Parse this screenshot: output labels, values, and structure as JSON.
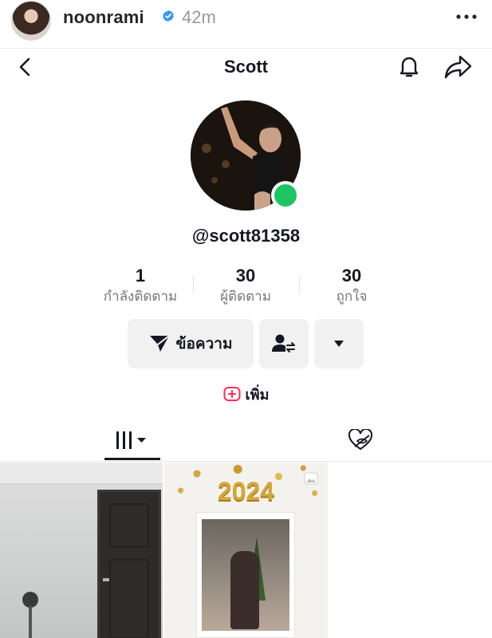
{
  "story": {
    "username": "noonrami",
    "time": "42m",
    "icons": {
      "verified": "verified-badge-icon",
      "more": "more-options-icon"
    },
    "colors": {
      "verified": "#3897f0"
    }
  },
  "nav": {
    "title": "Scott",
    "icons": {
      "back": "back-chevron-icon",
      "notifications": "bell-icon",
      "share": "share-arrow-icon"
    }
  },
  "profile": {
    "handle": "@scott81358",
    "online": true,
    "colors": {
      "online": "#1ec563"
    },
    "stats": [
      {
        "value": "1",
        "label": "กำลังติดตาม"
      },
      {
        "value": "30",
        "label": "ผู้ติดตาม"
      },
      {
        "value": "30",
        "label": "ถูกใจ"
      }
    ],
    "actions": {
      "message_label": "ข้อความ",
      "message_icon": "send-plane-icon",
      "follow_icon": "user-swap-icon",
      "more_icon": "caret-down-icon"
    },
    "add_label": "เพิ่ม",
    "add_icon": "plus-square-icon",
    "colors_accent": "#fe2c55"
  },
  "tabs": [
    {
      "name": "videos",
      "icon": "grid-bars-icon",
      "active": true
    },
    {
      "name": "liked",
      "icon": "hidden-heart-icon",
      "active": false
    }
  ],
  "videos": [
    {
      "scene": "room-with-dark-door"
    },
    {
      "overlay_text": "2024",
      "scene": "new-year-photo-frame",
      "badge_icon": "image-badge-icon"
    }
  ]
}
